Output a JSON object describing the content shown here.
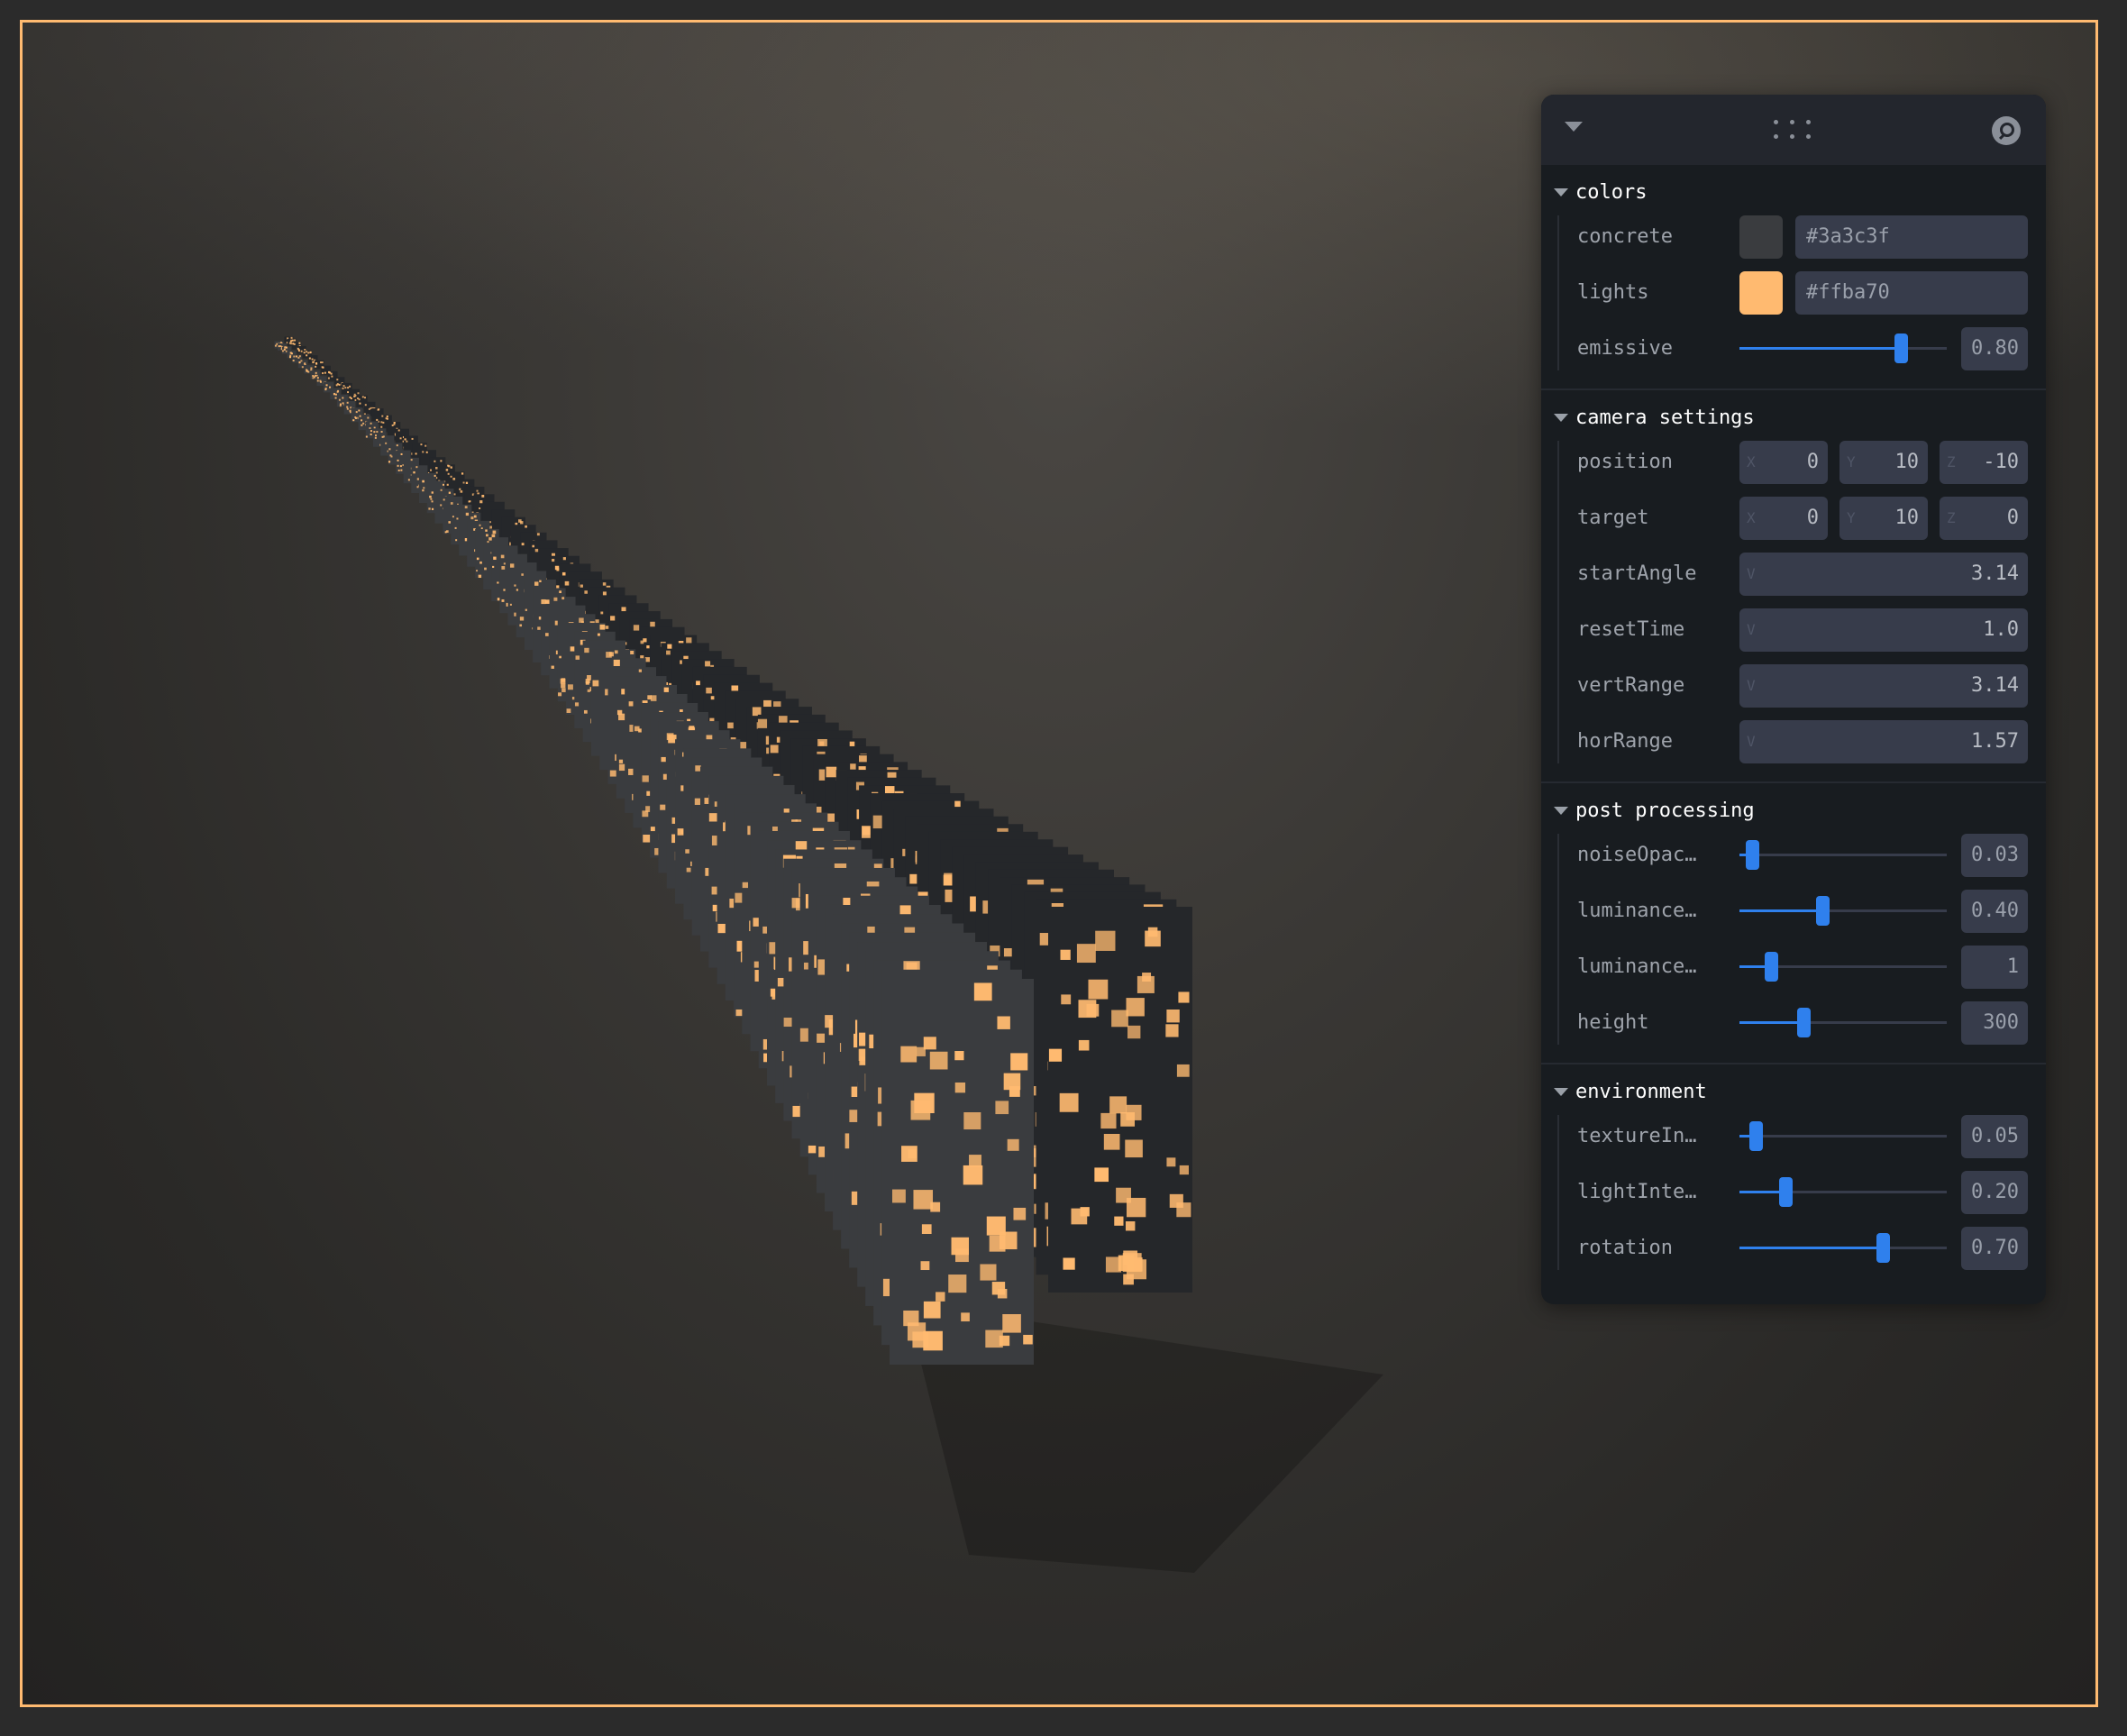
{
  "scene": {
    "border_color": "#ffba70",
    "concrete_color": "#3a3c3f",
    "light_color": "#ffba70"
  },
  "panel": {
    "icons": {
      "collapse": "caret-down-icon",
      "drag": "drag-handle-icon",
      "search": "search-icon"
    },
    "colors": {
      "title": "colors",
      "concrete": {
        "label": "concrete",
        "value": "#3a3c3f",
        "swatch": "#3a3c3f"
      },
      "lights": {
        "label": "lights",
        "value": "#ffba70",
        "swatch": "#ffba70"
      },
      "emissive": {
        "label": "emissive",
        "value": "0.80",
        "fraction": 0.78
      }
    },
    "camera": {
      "title": "camera settings",
      "position": {
        "label": "position",
        "x": "0",
        "y": "10",
        "z": "-10"
      },
      "target": {
        "label": "target",
        "x": "0",
        "y": "10",
        "z": "0"
      },
      "axis_x": "X",
      "axis_y": "Y",
      "axis_z": "Z",
      "axis_v": "V",
      "startAngle": {
        "label": "startAngle",
        "value": "3.14"
      },
      "resetTime": {
        "label": "resetTime",
        "value": "1.0"
      },
      "vertRange": {
        "label": "vertRange",
        "value": "3.14"
      },
      "horRange": {
        "label": "horRange",
        "value": "1.57"
      }
    },
    "post": {
      "title": "post processing",
      "noise": {
        "label": "noiseOpac…",
        "value": "0.03",
        "fraction": 0.06
      },
      "lum1": {
        "label": "luminance…",
        "value": "0.40",
        "fraction": 0.4
      },
      "lum2": {
        "label": "luminance…",
        "value": "1",
        "fraction": 0.15
      },
      "height": {
        "label": "height",
        "value": "300",
        "fraction": 0.31
      }
    },
    "environment": {
      "title": "environment",
      "texture": {
        "label": "textureIn…",
        "value": "0.05",
        "fraction": 0.08
      },
      "light": {
        "label": "lightInte…",
        "value": "0.20",
        "fraction": 0.22
      },
      "rotation": {
        "label": "rotation",
        "value": "0.70",
        "fraction": 0.69
      }
    }
  }
}
